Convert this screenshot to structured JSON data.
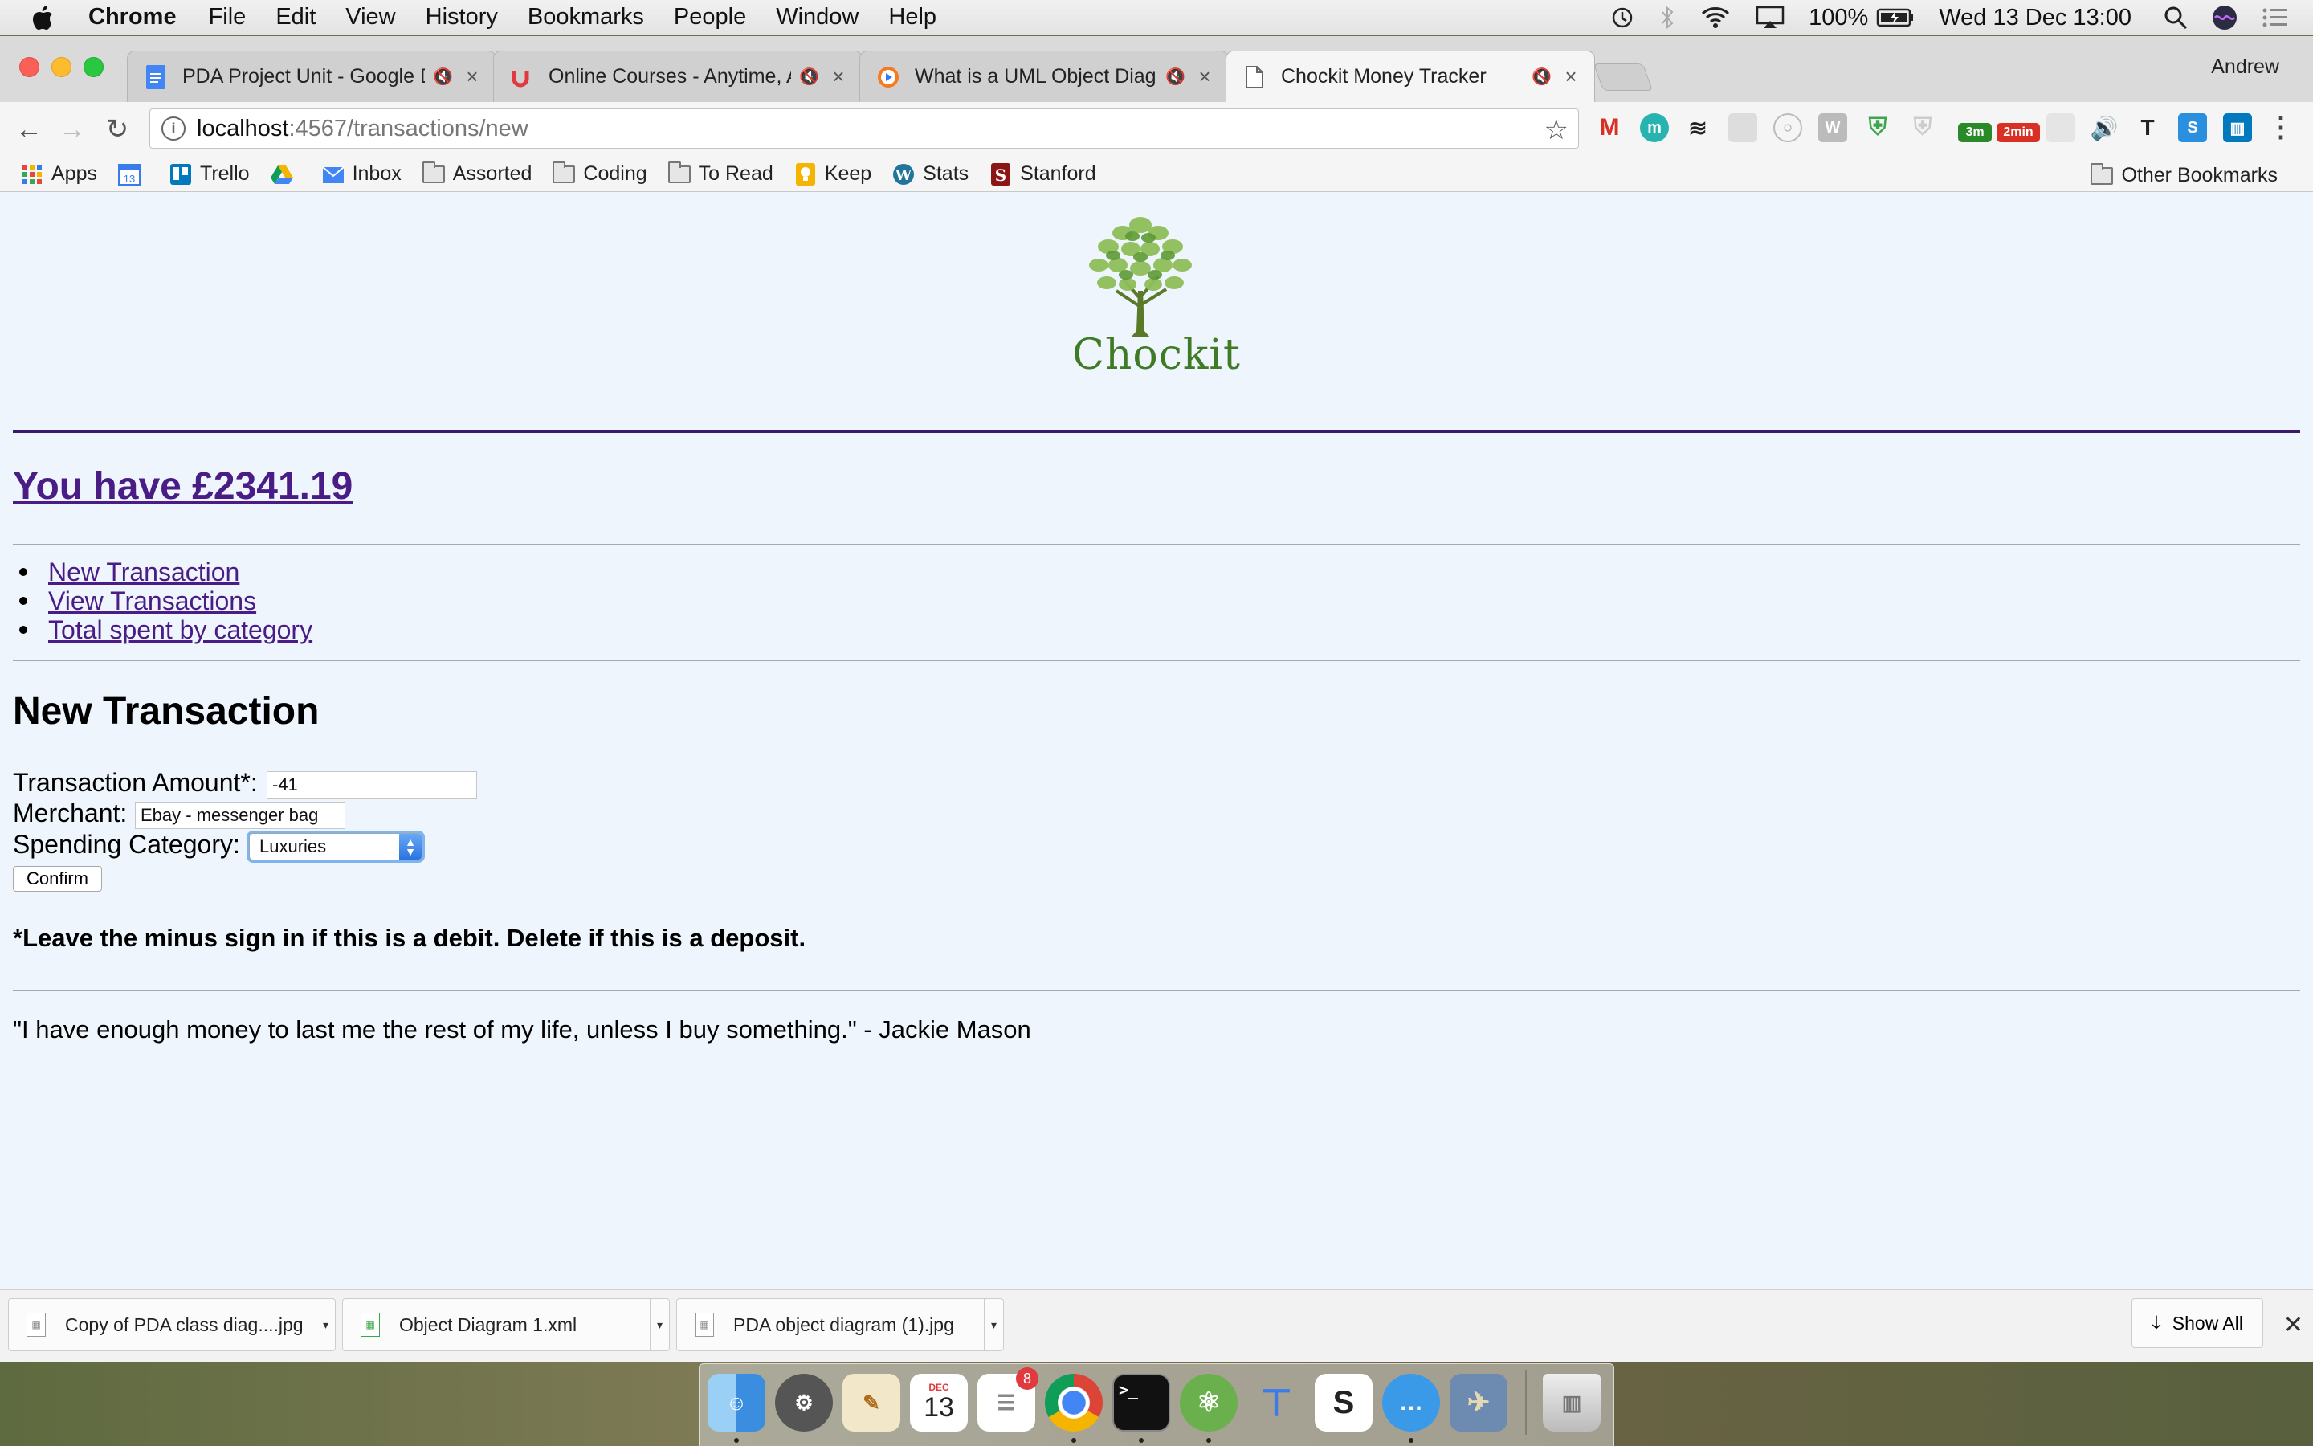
{
  "menubar": {
    "app_name": "Chrome",
    "items": [
      "File",
      "Edit",
      "View",
      "History",
      "Bookmarks",
      "People",
      "Window",
      "Help"
    ],
    "battery": "100%",
    "datetime": "Wed 13 Dec  13:00"
  },
  "tabs": [
    {
      "title": "PDA Project Unit - Google D",
      "icon": "google-docs-icon"
    },
    {
      "title": "Online Courses - Anytime, A",
      "icon": "udemy-icon"
    },
    {
      "title": "What is a UML Object Diagr",
      "icon": "video-play-icon"
    },
    {
      "title": "Chockit Money Tracker",
      "icon": "page-icon"
    }
  ],
  "profile_name": "Andrew",
  "address_bar": {
    "host": "localhost",
    "path": ":4567/transactions/new"
  },
  "extensions_badges": {
    "b1": "3m",
    "b2": "2min"
  },
  "bookmarks": [
    "Apps",
    "Trello",
    "Inbox",
    "Assorted",
    "Coding",
    "To Read",
    "Keep",
    "Stats",
    "Stanford"
  ],
  "other_bookmarks": "Other Bookmarks",
  "page": {
    "logo_text": "Chockit",
    "balance": "You have £2341.19",
    "nav_links": [
      "New Transaction",
      "View Transactions",
      "Total spent by category"
    ],
    "form": {
      "heading": "New Transaction",
      "amount_label": "Transaction Amount*:",
      "amount_value": "-41",
      "merchant_label": "Merchant:",
      "merchant_value": "Ebay - messenger bag",
      "category_label": "Spending Category:",
      "category_value": "Luxuries",
      "confirm_label": "Confirm"
    },
    "note": "*Leave the minus sign in if this is a debit. Delete if this is a deposit.",
    "quote": "\"I have enough money to last me the rest of my life, unless I buy something.\" - Jackie Mason"
  },
  "downloads": [
    {
      "name": "Copy of PDA class diag....jpg"
    },
    {
      "name": "Object Diagram 1.xml"
    },
    {
      "name": "PDA object diagram (1).jpg"
    }
  ],
  "show_all": "Show All",
  "dock": {
    "reminders_badge": "8",
    "calendar_day": "13",
    "calendar_month": "DEC"
  },
  "colors": {
    "link": "#4a1d86",
    "rule": "#3b1a6b",
    "page_bg": "#eef5fc",
    "logo_green": "#3f7a25"
  }
}
